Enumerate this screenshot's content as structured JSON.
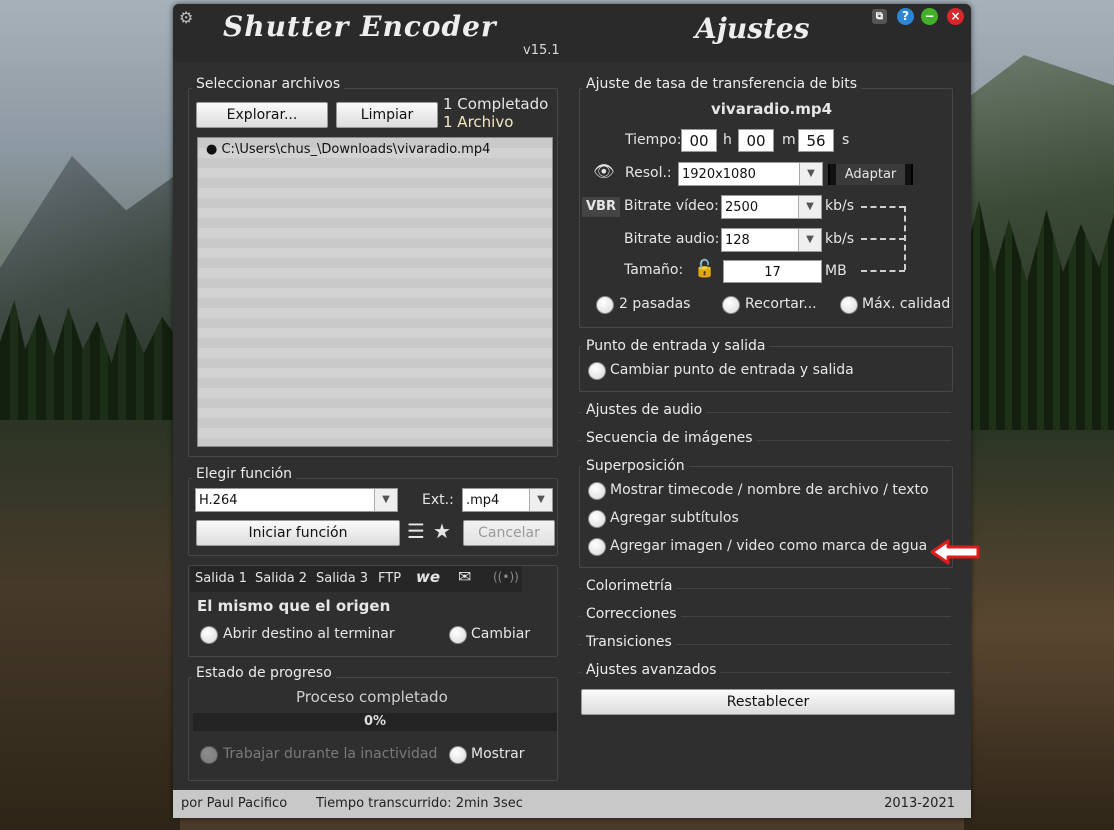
{
  "window": {
    "title": "Shutter Encoder",
    "version": "v15.1",
    "panel_title": "Ajustes"
  },
  "files": {
    "section_title": "Seleccionar archivos",
    "browse_label": "Explorar...",
    "clear_label": "Limpiar",
    "completed_text": "1 Completado",
    "count_text": "1 Archivo",
    "items": [
      "C:\\Users\\chus_\\Downloads\\vivaradio.mp4"
    ]
  },
  "function": {
    "section_title": "Elegir función",
    "selected": "H.264",
    "ext_label": "Ext.:",
    "ext_value": ".mp4",
    "start_label": "Iniciar función",
    "cancel_label": "Cancelar"
  },
  "output": {
    "tabs": [
      "Salida 1",
      "Salida 2",
      "Salida 3",
      "FTP"
    ],
    "destination_text": "El mismo que el origen",
    "open_on_finish_label": "Abrir destino al terminar",
    "change_label": "Cambiar"
  },
  "progress": {
    "section_title": "Estado de progreso",
    "status_text": "Proceso completado",
    "percent_text": "0%",
    "percent_value": 0,
    "idle_label": "Trabajar durante la inactividad",
    "show_label": "Mostrar"
  },
  "bitrate": {
    "section_title": "Ajuste de tasa de transferencia de bits",
    "filename": "vivaradio.mp4",
    "time_label": "Tiempo:",
    "hours": "00",
    "h_unit": "h",
    "minutes": "00",
    "m_unit": "m",
    "seconds": "56",
    "s_unit": "s",
    "resol_label": "Resol.:",
    "resol_value": "1920x1080",
    "adapt_label": "Adaptar",
    "vbr_label": "VBR",
    "video_bitrate_label": "Bitrate vídeo:",
    "video_bitrate_value": "2500",
    "audio_bitrate_label": "Bitrate audio:",
    "audio_bitrate_value": "128",
    "unit_kbs": "kb/s",
    "size_label": "Tamaño:",
    "size_value": "17",
    "size_unit": "MB",
    "two_pass_label": "2 pasadas",
    "trim_label": "Recortar...",
    "max_quality_label": "Máx. calidad"
  },
  "inout": {
    "section_title": "Punto de entrada y salida",
    "change_label": "Cambiar punto de entrada y salida"
  },
  "collapsed_sections": {
    "audio": "Ajustes de audio",
    "image_sequence": "Secuencia de imágenes"
  },
  "overlay": {
    "section_title": "Superposición",
    "options": [
      "Mostrar timecode / nombre de archivo / texto",
      "Agregar subtítulos",
      "Agregar imagen / video como marca de agua"
    ]
  },
  "lower_sections": [
    "Colorimetría",
    "Correcciones",
    "Transiciones",
    "Ajustes avanzados"
  ],
  "reset_label": "Restablecer",
  "statusbar": {
    "author": "por Paul Pacifico",
    "elapsed": "Tiempo transcurrido: 2min 3sec",
    "years": "2013-2021"
  },
  "colors": {
    "accent": "#4aa3df",
    "arrow": "#e01b1b",
    "window_bg": "#2f2f2f"
  }
}
